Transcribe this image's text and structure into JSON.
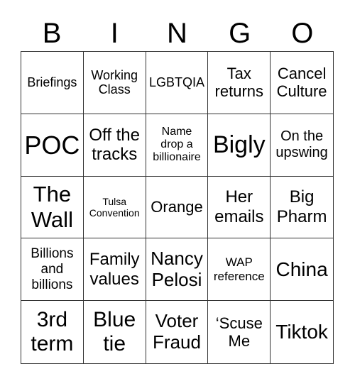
{
  "header": {
    "letters": [
      "B",
      "I",
      "N",
      "G",
      "O"
    ]
  },
  "card": {
    "cells": [
      "Briefings",
      "Working\nClass",
      "LGBTQIA",
      "Tax\nreturns",
      "Cancel\nCulture",
      "POC",
      "Off the\ntracks",
      "Name\ndrop a\nbillionaire",
      "Bigly",
      "On the\nupswing",
      "The\nWall",
      "Tulsa\nConvention",
      "Orange",
      "Her\nemails",
      "Big\nPharm",
      "Billions\nand\nbillions",
      "Family\nvalues",
      "Nancy\nPelosi",
      "WAP\nreference",
      "China",
      "3rd\nterm",
      "Blue\ntie",
      "Voter\nFraud",
      "‘Scuse\nMe",
      "Tiktok"
    ]
  },
  "colors": {
    "grid_line": "#333333",
    "background": "#ffffff",
    "text": "#000000"
  }
}
